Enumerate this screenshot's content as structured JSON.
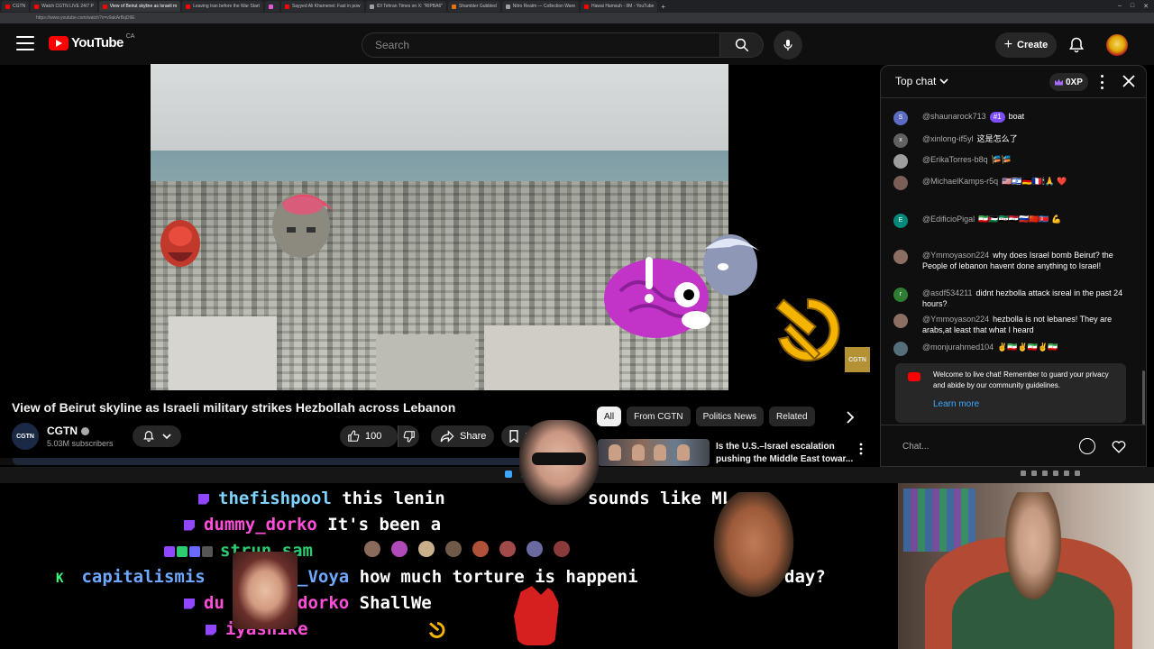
{
  "browser": {
    "tabs": [
      {
        "label": "CGTN",
        "icon": "dot-red",
        "active": false
      },
      {
        "label": "Watch CGTN LIVE 24/7 P",
        "icon": "dot-red",
        "active": false
      },
      {
        "label": "View of Beirut skyline as Israeli m",
        "icon": "dot-red",
        "active": true
      },
      {
        "label": "Leaving Iran before the War Start",
        "icon": "dot-red",
        "active": false
      },
      {
        "label": "",
        "icon": "dot-pink",
        "active": false
      },
      {
        "label": "Sayyed Ali Khamenei: Fast in pow",
        "icon": "dot-red",
        "active": false
      },
      {
        "label": "IDI Tehran Times on X: \"RIPBA6\"",
        "icon": "dot-gray",
        "active": false
      },
      {
        "label": "Shambler Gubbled",
        "icon": "dot-orange",
        "active": false
      },
      {
        "label": "Nitro Realm — Collection Ware",
        "icon": "dot-gray",
        "active": false
      },
      {
        "label": "Hawai Hamsuh - IIM - YouTube",
        "icon": "dot-red",
        "active": false
      }
    ],
    "url": "https://www.youtube.com/watch?v=v9akArBqD9E"
  },
  "header": {
    "logo_text": "YouTube",
    "country": "CA",
    "search_placeholder": "Search",
    "create_label": "Create",
    "icons": [
      "menu-icon",
      "search-icon",
      "mic-icon",
      "bell-icon",
      "avatar"
    ]
  },
  "video": {
    "watermark": "CGTN",
    "title": "View of Beirut skyline as Israeli military strikes Hezbollah across Lebanon",
    "channel": {
      "name": "CGTN",
      "avatar_text": "CGTN",
      "subscribers": "5.03M subscribers"
    },
    "likes": "100",
    "share_label": "Share",
    "save_label": "S"
  },
  "chips": [
    "All",
    "From CGTN",
    "Politics News",
    "Related"
  ],
  "related": [
    {
      "title": "Is the U.S.–Israel escalation pushing the Middle East towar..."
    }
  ],
  "chat": {
    "header": "Top chat",
    "xp": "0XP",
    "messages": [
      {
        "author": "@shaunarock713",
        "badge": "#1",
        "text": "boat",
        "avatar_letter": "S",
        "avatar_color": "#5c6bc0"
      },
      {
        "author": "@xinlong-if5yl",
        "text": "这是怎么了",
        "avatar_letter": "x",
        "avatar_color": "#616161"
      },
      {
        "author": "@ErikaTorres-b8q",
        "text": "🎏🎏",
        "avatar_letter": "",
        "avatar_color": "#9e9e9e"
      },
      {
        "author": "@MichaelKamps-r5q",
        "text": "🇺🇸🇮🇱🇩🇪🇫🇷🕯🙏 ❤️",
        "avatar_letter": "",
        "avatar_color": "#7b5e57"
      },
      {
        "author": "@EdificioPigal",
        "text": "🇮🇷🇵🇸🇸🇾🇮🇶🇷🇺🇨🇳🇰🇵 💪",
        "avatar_letter": "E",
        "avatar_color": "#00897b"
      },
      {
        "author": "@Ymmoyason224",
        "text": "why does Israel bomb Beirut? the People of lebanon havent done anything to Israel!",
        "avatar_letter": "",
        "avatar_color": "#8d6e63"
      },
      {
        "author": "@asdf534211",
        "text": "didnt hezbolla attack isreal in the past 24 hours?",
        "avatar_letter": "r",
        "avatar_color": "#2e7d32"
      },
      {
        "author": "@Ymmoyason224",
        "text": "hezbolla is not lebanes! They are arabs,at least that what I heard",
        "avatar_letter": "",
        "avatar_color": "#8d6e63"
      },
      {
        "author": "@monjurahmed104",
        "text": "✌️🇮🇷✌️🇮🇷✌️🇮🇷",
        "avatar_letter": "",
        "avatar_color": "#546e7a"
      }
    ],
    "welcome": "Welcome to live chat! Remember to guard your privacy and abide by our community guidelines.",
    "learn_more": "Learn more",
    "input_placeholder": "Chat..."
  },
  "stream_chat": [
    {
      "user": "thefishpool",
      "text": "this lenin",
      "text2": "sounds like",
      "text3": "ML"
    },
    {
      "user": "dummy_dorko",
      "text": "It's been a"
    },
    {
      "user": "strun_sam",
      "text": ""
    },
    {
      "user_a": "capitalismis",
      "user_b": "_Voya",
      "text": "how much torture is happeni",
      "text2": "day?"
    },
    {
      "user_a": "du",
      "user_b": "dorko",
      "text": "ShallWe"
    },
    {
      "user": "iyashike",
      "text": ""
    }
  ],
  "colors": {
    "accent": "#ff0000",
    "link": "#3ea6ff",
    "background": "#0f0f0f",
    "twitch": "#9146ff"
  }
}
